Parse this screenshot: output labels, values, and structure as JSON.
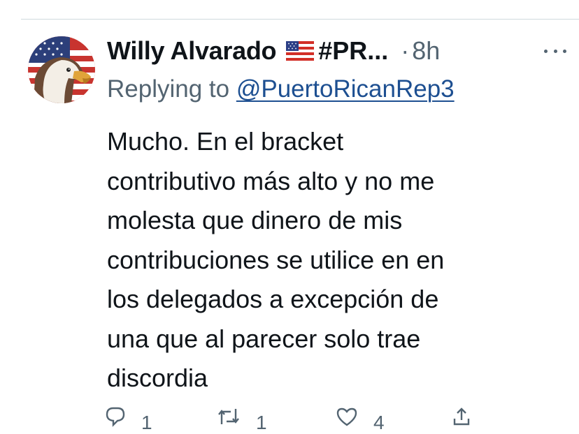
{
  "tweet": {
    "display_name": "Willy Alvarado",
    "flag_emoji": "🇺🇸",
    "name_suffix": "#PR...",
    "separator": "·",
    "timestamp": "8h",
    "reply_prefix": "Replying to ",
    "reply_handle": "@PuertoRicanRep3",
    "text": "Mucho. En el bracket\ncontributivo más alto y no me\nmolesta que dinero de mis\ncontribuciones se utilice en en\nlos delegados a excepción de\nuna que al parecer solo trae\ndiscordia",
    "actions": {
      "reply_count": "1",
      "retweet_count": "1",
      "like_count": "4"
    }
  },
  "icons": {
    "avatar": "eagle-flag-avatar",
    "flag": "us-flag-icon",
    "more": "more-icon",
    "reply": "reply-icon",
    "retweet": "retweet-icon",
    "like": "heart-icon",
    "share": "share-icon"
  },
  "colors": {
    "text_primary": "#0f1419",
    "text_secondary": "#536471",
    "link": "#1d4f91",
    "divider": "#cfd9de"
  }
}
